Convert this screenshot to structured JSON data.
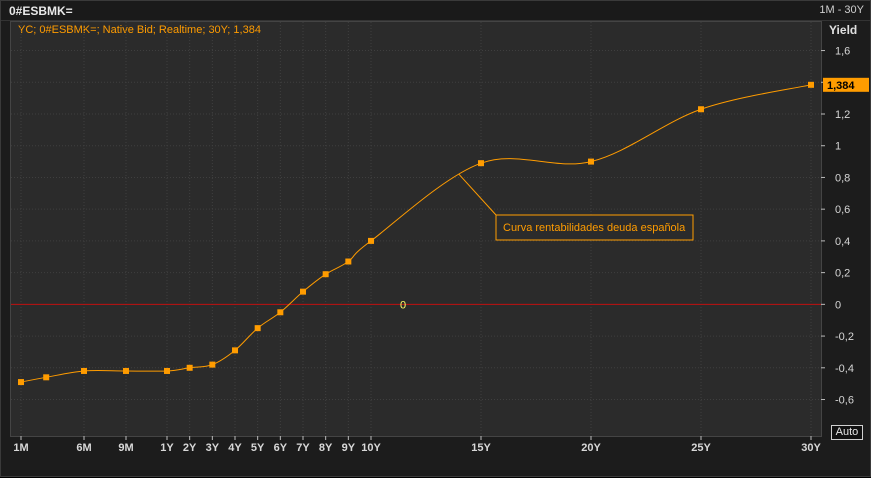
{
  "header": {
    "ric": "0#ESBMK=",
    "range": "1M - 30Y"
  },
  "legend": {
    "text": "YC; 0#ESBMK=; Native Bid; Realtime; 30Y; 1,384"
  },
  "axis": {
    "y_title": "Yield",
    "auto_label": "Auto"
  },
  "last_value_tag": "1,384",
  "zero_label": "0",
  "annotation": "Curva rentabilidades deuda española",
  "colors": {
    "series": "#ff9c00",
    "zero_line": "#c01010",
    "grid": "#3f3f3f",
    "background": "#2b2b2b"
  },
  "chart_data": {
    "type": "line",
    "x_scale": "maturity (years)",
    "series": [
      {
        "name": "",
        "points": [
          {
            "label": "1M",
            "x": 0.0833,
            "y": -0.49
          },
          {
            "label": "",
            "x": 0.25,
            "y": -0.46
          },
          {
            "label": "6M",
            "x": 0.5,
            "y": -0.42
          },
          {
            "label": "9M",
            "x": 0.75,
            "y": -0.42
          },
          {
            "label": "1Y",
            "x": 1,
            "y": -0.42
          },
          {
            "label": "2Y",
            "x": 2,
            "y": -0.4
          },
          {
            "label": "3Y",
            "x": 3,
            "y": -0.38
          },
          {
            "label": "4Y",
            "x": 4,
            "y": -0.29
          },
          {
            "label": "5Y",
            "x": 5,
            "y": -0.15
          },
          {
            "label": "6Y",
            "x": 6,
            "y": -0.05
          },
          {
            "label": "7Y",
            "x": 7,
            "y": 0.08
          },
          {
            "label": "8Y",
            "x": 8,
            "y": 0.19
          },
          {
            "label": "9Y",
            "x": 9,
            "y": 0.27
          },
          {
            "label": "10Y",
            "x": 10,
            "y": 0.4
          },
          {
            "label": "15Y",
            "x": 15,
            "y": 0.89
          },
          {
            "label": "20Y",
            "x": 20,
            "y": 0.9
          },
          {
            "label": "25Y",
            "x": 25,
            "y": 1.23
          },
          {
            "label": "30Y",
            "x": 30,
            "y": 1.384
          }
        ]
      }
    ],
    "x_tick_labels": [
      "1M",
      "6M",
      "9M",
      "1Y",
      "2Y",
      "3Y",
      "4Y",
      "5Y",
      "6Y",
      "7Y",
      "8Y",
      "9Y",
      "10Y",
      "15Y",
      "20Y",
      "25Y",
      "30Y"
    ],
    "y_ticks": [
      {
        "v": 1.6,
        "label": "1,6"
      },
      {
        "v": 1.4,
        "label": "1,4"
      },
      {
        "v": 1.2,
        "label": "1,2"
      },
      {
        "v": 1.0,
        "label": "1"
      },
      {
        "v": 0.8,
        "label": "0,8"
      },
      {
        "v": 0.6,
        "label": "0,6"
      },
      {
        "v": 0.4,
        "label": "0,4"
      },
      {
        "v": 0.2,
        "label": "0,2"
      },
      {
        "v": 0,
        "label": "0"
      },
      {
        "v": -0.2,
        "label": "-0,2"
      },
      {
        "v": -0.4,
        "label": "-0,4"
      },
      {
        "v": -0.6,
        "label": "-0,6"
      }
    ],
    "ylim": [
      -0.83,
      1.78
    ],
    "grid": true
  }
}
